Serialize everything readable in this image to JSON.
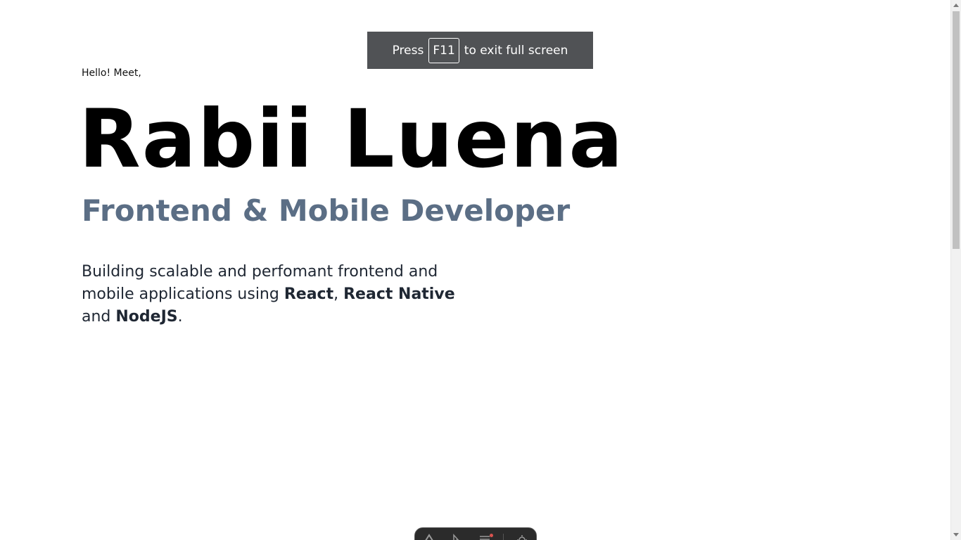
{
  "fullscreen_notice": {
    "press": "Press",
    "key": "F11",
    "suffix": "to exit full screen"
  },
  "hero": {
    "greeting": "Hello! Meet,",
    "name": "Rabii Luena",
    "role": "Frontend & Mobile Developer",
    "description": {
      "part1": "Building scalable and perfomant frontend and mobile applications using ",
      "tech1": "React",
      "sep1": ", ",
      "tech2": "React Native",
      "part2": " and ",
      "tech3": "NodeJS",
      "part3": "."
    }
  },
  "dock": {
    "icons": [
      "logo-icon",
      "pointer-icon",
      "menu-icon",
      "settings-icon"
    ]
  },
  "colors": {
    "background": "#ffffff",
    "name": "#000000",
    "role": "#5b6e85",
    "body_text": "#1f2733",
    "notice_bg": "#505255"
  }
}
